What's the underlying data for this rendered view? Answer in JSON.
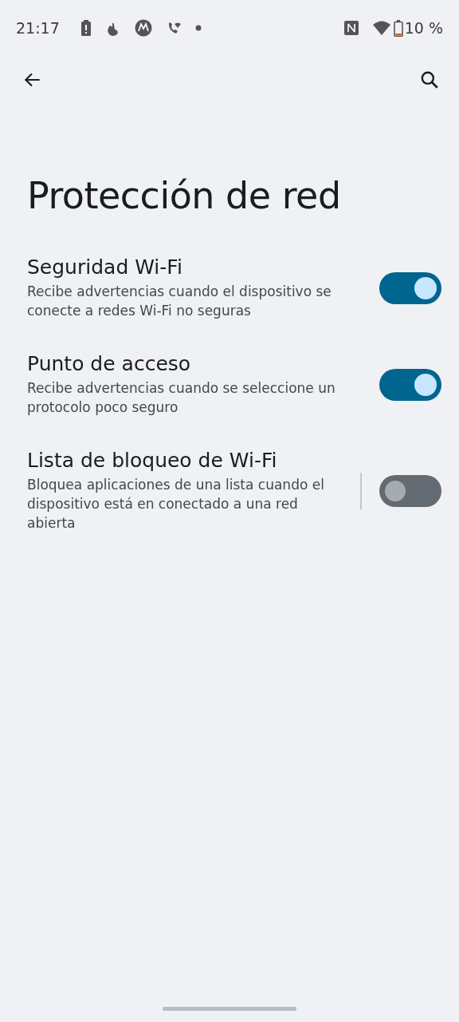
{
  "status_bar": {
    "time": "21:17",
    "battery_text": "10 %"
  },
  "title": "Protección de red",
  "settings": [
    {
      "title": "Seguridad Wi-Fi",
      "summary": "Recibe advertencias cuando el dispositivo se conecte a redes Wi-Fi no seguras",
      "on": true,
      "divider": false
    },
    {
      "title": "Punto de acceso",
      "summary": "Recibe advertencias cuando se seleccione un protocolo poco seguro",
      "on": true,
      "divider": false
    },
    {
      "title": "Lista de bloqueo de Wi-Fi",
      "summary": "Bloquea aplicaciones de una lista cuando el dispositivo está en conectado a una red abierta",
      "on": false,
      "divider": true
    }
  ]
}
